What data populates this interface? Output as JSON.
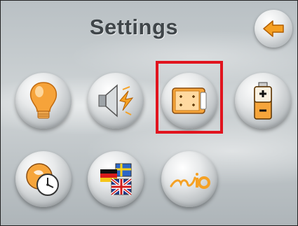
{
  "header": {
    "title": "Settings",
    "back_button": {
      "icon": "back-arrow-icon"
    }
  },
  "grid": {
    "items": [
      {
        "name": "brightness",
        "icon": "lightbulb-icon"
      },
      {
        "name": "volume",
        "icon": "speaker-icon"
      },
      {
        "name": "screen",
        "icon": "screen-calibration-icon",
        "selected": true
      },
      {
        "name": "power",
        "icon": "battery-icon"
      },
      {
        "name": "time",
        "icon": "clock-icon"
      },
      {
        "name": "language",
        "icon": "flags-icon"
      },
      {
        "name": "about",
        "icon": "mio-logo-icon",
        "logo_text": "Mio"
      }
    ]
  },
  "colors": {
    "highlight": "#e1141e",
    "accent_orange": "#f29a1f",
    "title": "#3f4549"
  }
}
